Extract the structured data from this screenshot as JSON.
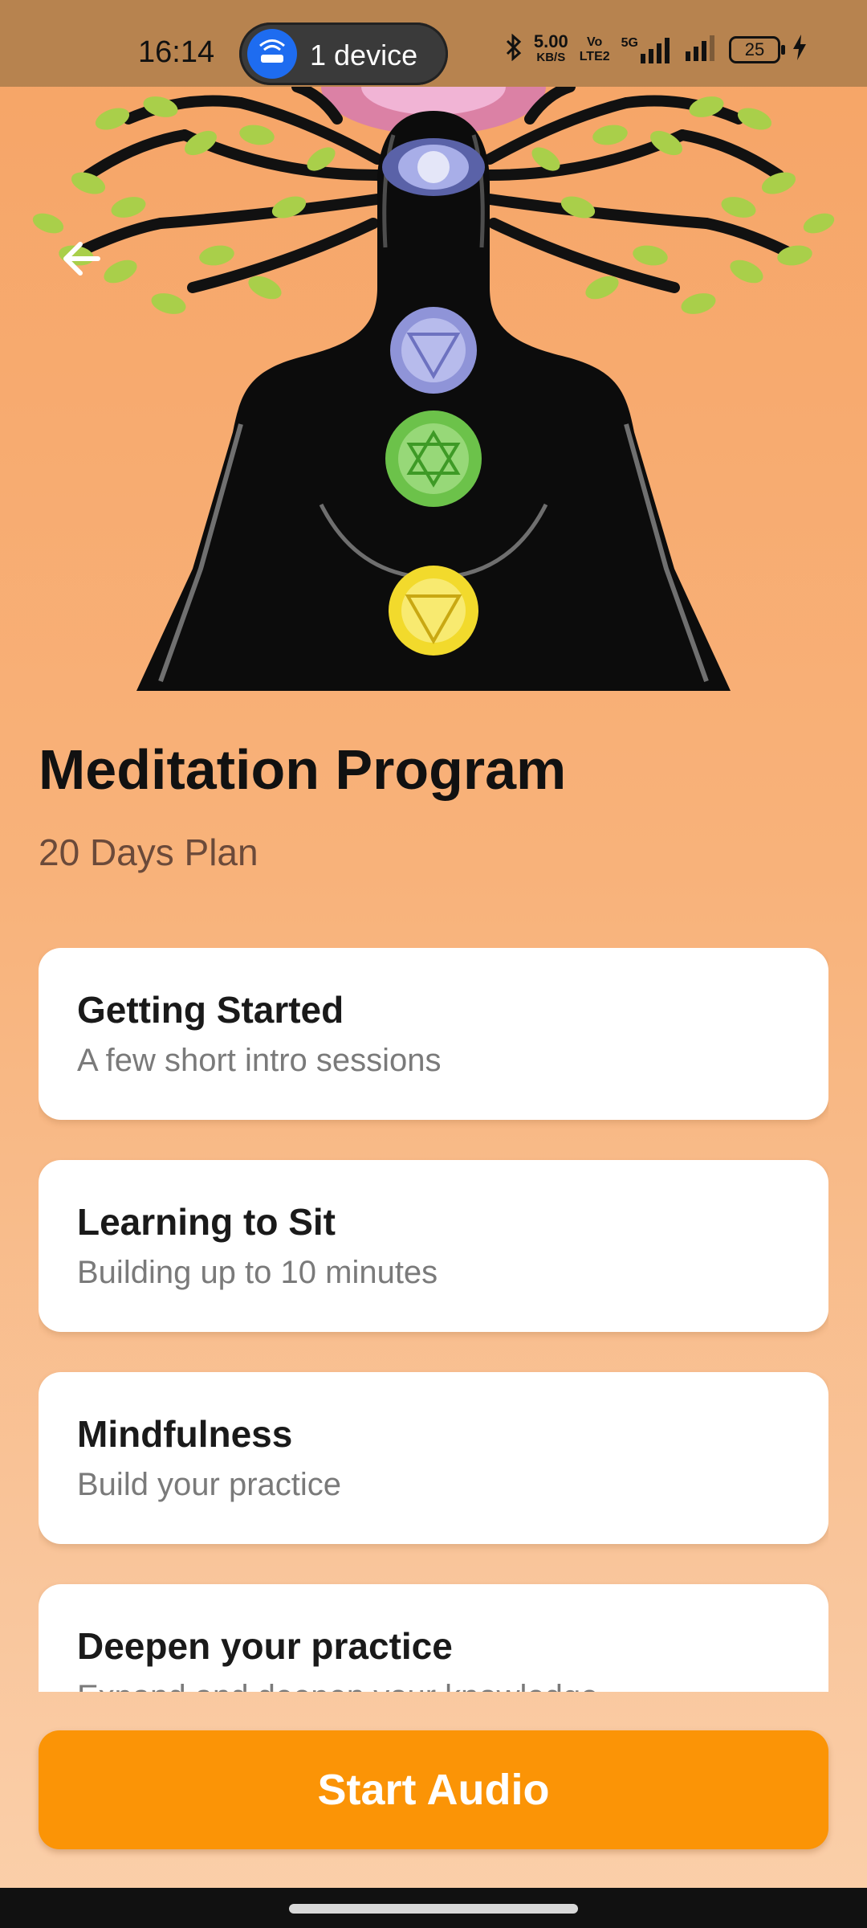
{
  "status_bar": {
    "time": "16:14",
    "device_pill": "1 device",
    "net_speed_value": "5.00",
    "net_speed_unit": "KB/S",
    "volte_top": "Vo",
    "volte_bottom": "LTE2",
    "network_type": "5G",
    "battery_level": "25",
    "icons": [
      "hotspot-icon",
      "bluetooth-icon",
      "signal-icon",
      "battery-icon",
      "charging-icon"
    ]
  },
  "header": {
    "back_icon": "arrow-left-icon",
    "hero_image": "chakra-meditation-tree-illustration"
  },
  "program": {
    "title": "Meditation Program",
    "subtitle": "20 Days Plan"
  },
  "sessions": [
    {
      "title": "Getting Started",
      "description": "A few short intro sessions"
    },
    {
      "title": "Learning to Sit",
      "description": "Building up to 10 minutes"
    },
    {
      "title": "Mindfulness",
      "description": "Build your practice"
    },
    {
      "title": "Deepen your practice",
      "description": "Expand and deepen your knowledge"
    }
  ],
  "actions": {
    "start_label": "Start Audio"
  },
  "colors": {
    "background_top": "#f6a466",
    "background_bottom": "#fbd0aa",
    "status_bar": "#b7834f",
    "accent_button": "#fb9406",
    "card": "#ffffff",
    "leaf_green": "#a9cf4a",
    "chakra_indigo": "#8f94d8",
    "chakra_green": "#6cc24a",
    "chakra_yellow": "#f2da2c"
  }
}
